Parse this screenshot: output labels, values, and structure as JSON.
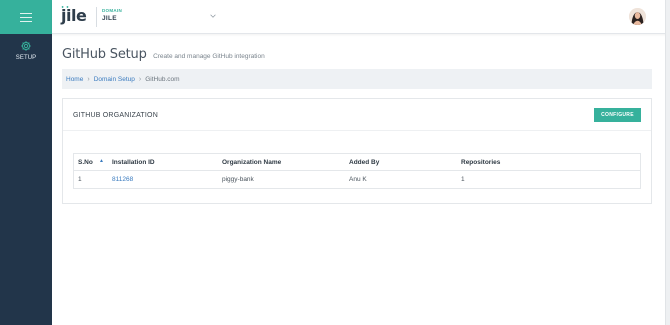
{
  "header": {
    "logo_text": "jile",
    "domain_label": "DOMAIN",
    "domain_value": "JILE"
  },
  "sidebar": {
    "items": [
      {
        "label": "SETUP",
        "icon": "gear-icon"
      }
    ]
  },
  "page": {
    "title": "GitHub Setup",
    "subtitle": "Create and manage GitHub integration"
  },
  "breadcrumb": {
    "items": [
      "Home",
      "Domain Setup",
      "GitHub.com"
    ]
  },
  "card": {
    "title": "GITHUB ORGANIZATION",
    "configure_label": "CONFIGURE"
  },
  "table": {
    "columns": [
      "S.No",
      "Installation ID",
      "Organization Name",
      "Added By",
      "Repositories"
    ],
    "rows": [
      [
        "1",
        "811268",
        "piggy-bank",
        "Anu K",
        "1"
      ]
    ]
  },
  "colors": {
    "accent": "#36b19c",
    "sidebar": "#22354a",
    "link": "#3a7bbf"
  }
}
